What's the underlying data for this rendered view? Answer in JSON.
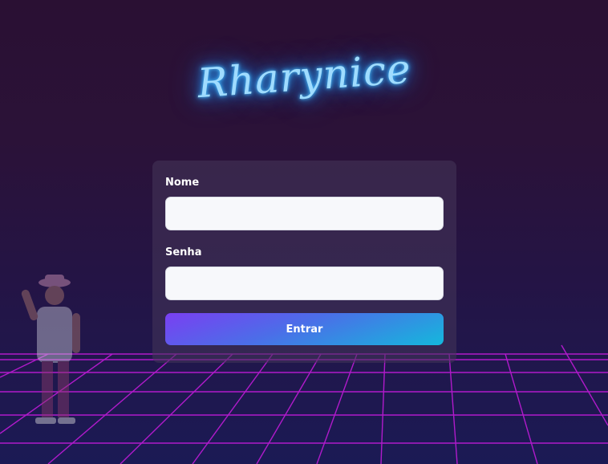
{
  "brand": {
    "logo_text": "Rharynice"
  },
  "login_form": {
    "name_label": "Nome",
    "name_value": "",
    "password_label": "Senha",
    "password_value": "",
    "submit_label": "Entrar"
  },
  "colors": {
    "logo_glow": "#2ea8ff",
    "grid_line": "#c01bd8",
    "button_start": "#7a3ff2",
    "button_end": "#14b8dc"
  }
}
